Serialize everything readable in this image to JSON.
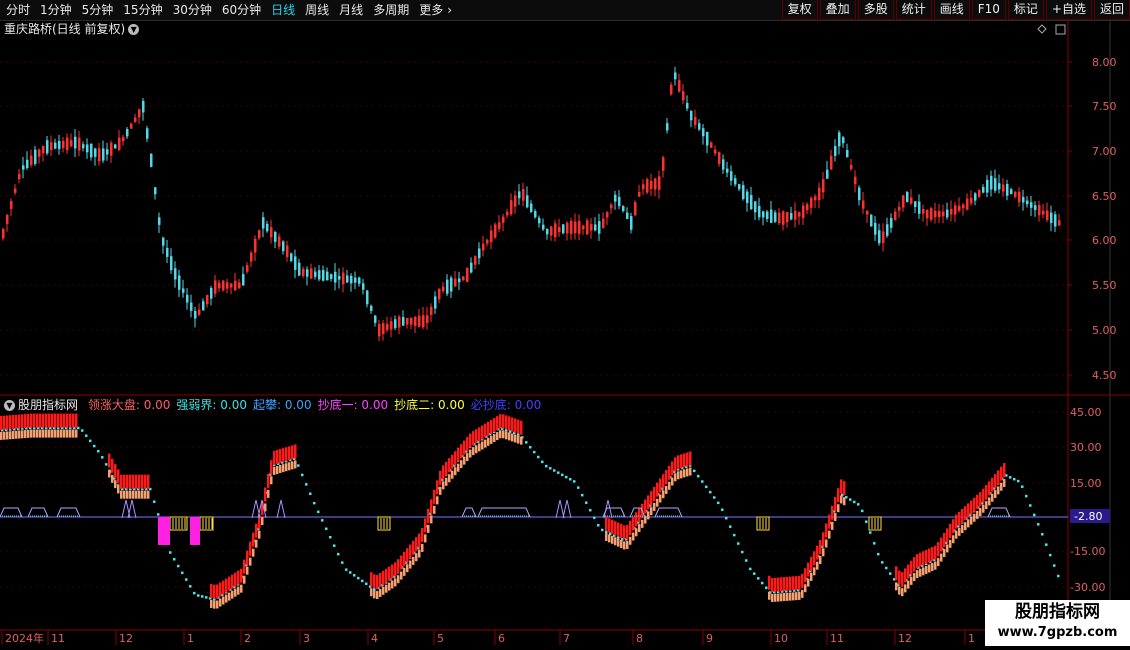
{
  "toolbar": {
    "tabs": [
      {
        "label": "分时",
        "active": false
      },
      {
        "label": "1分钟",
        "active": false
      },
      {
        "label": "5分钟",
        "active": false
      },
      {
        "label": "15分钟",
        "active": false
      },
      {
        "label": "30分钟",
        "active": false
      },
      {
        "label": "60分钟",
        "active": false
      },
      {
        "label": "日线",
        "active": true
      },
      {
        "label": "周线",
        "active": false
      },
      {
        "label": "月线",
        "active": false
      },
      {
        "label": "多周期",
        "active": false
      },
      {
        "label": "更多",
        "active": false
      }
    ],
    "more_arrow": "›",
    "actions": [
      "复权",
      "叠加",
      "多股",
      "统计",
      "画线",
      "F10",
      "标记",
      "+自选",
      "返回"
    ]
  },
  "main_chart": {
    "title": "重庆路桥(日线 前复权)",
    "y_ticks": [
      "8.00",
      "7.50",
      "7.00",
      "6.50",
      "6.00",
      "5.50",
      "5.00",
      "4.50"
    ]
  },
  "indicator": {
    "name": "股朋指标网",
    "items": [
      {
        "label": "领涨大盘:",
        "value": "0.00",
        "color": "#ff6060"
      },
      {
        "label": "强弱界:",
        "value": "0.00",
        "color": "#40e0e0"
      },
      {
        "label": "起攀:",
        "value": "0.00",
        "color": "#40a0ff"
      },
      {
        "label": "抄底一:",
        "value": "0.00",
        "color": "#ff40ff"
      },
      {
        "label": "抄底二:",
        "value": "0.00",
        "color": "#ffff40"
      },
      {
        "label": "必抄底:",
        "value": "0.00",
        "color": "#4040ff"
      }
    ],
    "y_ticks": [
      "45.00",
      "30.00",
      "15.00",
      "-15.00",
      "-30.00"
    ],
    "current_value": "-2.80"
  },
  "time_axis": {
    "labels": [
      "2024年",
      "11",
      "12",
      "1",
      "2",
      "3",
      "4",
      "5",
      "6",
      "7",
      "8",
      "9",
      "10",
      "11",
      "12",
      "1"
    ]
  },
  "watermark": {
    "line1": "股朋指标网",
    "line2": "www.7gpzb.com"
  },
  "colors": {
    "up": "#ff3030",
    "down": "#54d8e8",
    "axis": "#8b0000",
    "active_tab": "#25d8e8"
  }
}
